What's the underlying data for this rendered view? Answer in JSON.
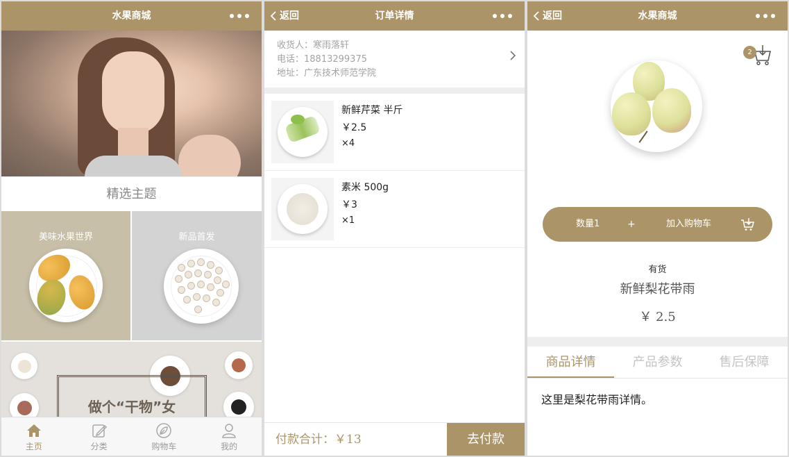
{
  "home": {
    "navbar": {
      "title": "水果商城"
    },
    "section_title": "精选主题",
    "themes": [
      {
        "label": "美味水果世界"
      },
      {
        "label": "新品首发"
      }
    ],
    "promo_slogan": "做个“干物”女",
    "tabs": [
      {
        "label": "主页",
        "icon": "home-icon",
        "active": true
      },
      {
        "label": "分类",
        "icon": "edit-icon",
        "active": false
      },
      {
        "label": "购物车",
        "icon": "leaf-icon",
        "active": false
      },
      {
        "label": "我的",
        "icon": "user-icon",
        "active": false
      }
    ]
  },
  "order": {
    "navbar": {
      "back": "返回",
      "title": "订单详情"
    },
    "address": {
      "receiver": "收货人：寒雨落轩",
      "phone": "电话：18813299375",
      "location": "地址：广东技术师范学院"
    },
    "items": [
      {
        "name": "新鲜芹菜 半斤",
        "price": "￥2.5",
        "qty": "×4"
      },
      {
        "name": "素米 500g",
        "price": "￥3",
        "qty": "×1"
      }
    ],
    "total": "付款合计：￥13",
    "pay_button": "去付款"
  },
  "product": {
    "navbar": {
      "back": "返回",
      "title": "水果商城"
    },
    "cart_count": "2",
    "quantity_label": "数量1",
    "plus": "+",
    "add_to_cart": "加入购物车",
    "stock": "有货",
    "name": "新鲜梨花带雨",
    "price": "￥ 2.5",
    "detail_tabs": [
      "商品详情",
      "产品参数",
      "售后保障"
    ],
    "detail_text": "这里是梨花带雨详情。"
  },
  "colors": {
    "accent": "#ab9467",
    "theme_a": "#c7bfa8",
    "theme_b": "#d3d3d3"
  }
}
